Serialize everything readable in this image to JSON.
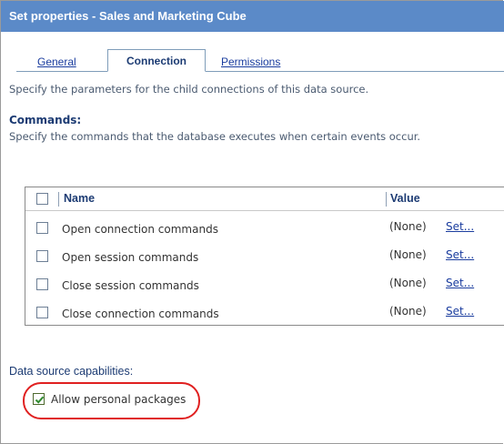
{
  "window": {
    "title": "Set properties - Sales and Marketing Cube"
  },
  "tabs": [
    {
      "label": "General",
      "active": false
    },
    {
      "label": "Connection",
      "active": true
    },
    {
      "label": "Permissions",
      "active": false
    }
  ],
  "connection": {
    "description": "Specify the parameters for the child connections of this data source.",
    "commands": {
      "title": "Commands:",
      "description": "Specify the commands that the database executes when certain events occur.",
      "columns": {
        "name": "Name",
        "value": "Value"
      },
      "rows": [
        {
          "name": "Open connection commands",
          "value": "(None)",
          "action": "Set..."
        },
        {
          "name": "Open session commands",
          "value": "(None)",
          "action": "Set..."
        },
        {
          "name": "Close session commands",
          "value": "(None)",
          "action": "Set..."
        },
        {
          "name": "Close connection commands",
          "value": "(None)",
          "action": "Set..."
        }
      ]
    },
    "capabilities": {
      "title": "Data source capabilities:",
      "allow_personal_packages": {
        "label": "Allow personal packages",
        "checked": true
      }
    }
  },
  "colors": {
    "titlebar": "#5b8ac8",
    "link": "#1a3c9e",
    "heading": "#1c3b73",
    "highlight": "#e02020"
  }
}
